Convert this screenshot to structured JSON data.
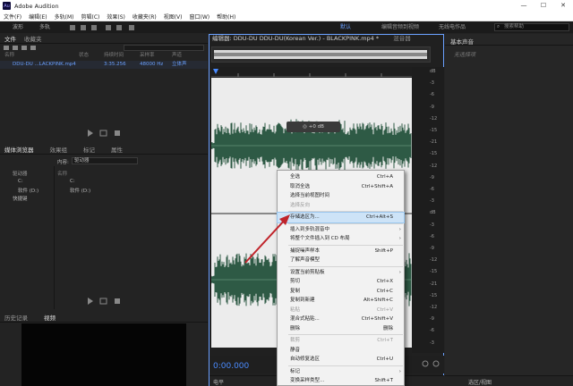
{
  "window": {
    "title": "Adobe Audition",
    "logo": "Au",
    "minimize": "—",
    "maximize": "☐",
    "close": "✕"
  },
  "menu": [
    "文件(F)",
    "编辑(E)",
    "多轨(M)",
    "剪辑(C)",
    "效果(S)",
    "收藏夹(R)",
    "视图(V)",
    "窗口(W)",
    "帮助(H)"
  ],
  "toolbar": {
    "wave_label": "波形",
    "multi_label": "多轨",
    "workspaces": [
      "默认",
      "编辑音频到视频",
      "无线电作品"
    ],
    "search_placeholder": "搜索帮助"
  },
  "files_panel": {
    "tabs": [
      "文件",
      "收藏夹"
    ],
    "columns": [
      "名称",
      "状态",
      "持续时间",
      "采样率",
      "声道"
    ],
    "row": {
      "name": "DDU-DU ...LACKPINK.mp4",
      "duration": "3:35.256",
      "rate": "48000 Hz",
      "channels": "立体声"
    }
  },
  "media_panel": {
    "tabs": [
      "媒体浏览器",
      "效果组",
      "标记",
      "属性"
    ],
    "content_label": "内容:",
    "content_value": "驱动器",
    "tree": [
      "驱动器",
      "C:",
      "软件 (D:)",
      "快捷键"
    ],
    "list_header": "名称",
    "list": [
      "C:",
      "软件 (D:)"
    ]
  },
  "history_panel": {
    "tabs": [
      "历史记录",
      "视频"
    ]
  },
  "editor": {
    "title": "编辑器: DDU-DU DDU-DU(Korean Ver.) - BLACKPINK.mp4 *",
    "mixer_tab": "混音器",
    "hud_label": "+0 dB",
    "time": "0:00.000",
    "db_labels": [
      "dB",
      "-3",
      "-6",
      "-9",
      "-12",
      "-15",
      "-21",
      "-15",
      "-12",
      "-9",
      "-6",
      "-3",
      "dB",
      "-3",
      "-6",
      "-9",
      "-12",
      "-15",
      "-21",
      "-15",
      "-12",
      "-9",
      "-6",
      "-3"
    ]
  },
  "context_menu": {
    "items": [
      {
        "label": "全选",
        "shortcut": "Ctrl+A"
      },
      {
        "label": "取消全选",
        "shortcut": "Ctrl+Shift+A"
      },
      {
        "label": "选择当前视图时间",
        "shortcut": ""
      },
      {
        "label": "选择反向",
        "shortcut": "",
        "disabled": true
      },
      {
        "sep": true
      },
      {
        "label": "存储选区为...",
        "shortcut": "Ctrl+Alt+S",
        "highlight": true
      },
      {
        "sep": true
      },
      {
        "label": "插入到多轨混音中",
        "shortcut": "",
        "submenu": true
      },
      {
        "label": "将整个文件插入到 CD 布局",
        "shortcut": "",
        "submenu": true
      },
      {
        "sep": true
      },
      {
        "label": "捕捉噪声样本",
        "shortcut": "Shift+P"
      },
      {
        "label": "了解声音模型",
        "shortcut": ""
      },
      {
        "sep": true
      },
      {
        "label": "设置当前剪贴板",
        "shortcut": "",
        "submenu": true
      },
      {
        "label": "剪切",
        "shortcut": "Ctrl+X"
      },
      {
        "label": "复制",
        "shortcut": "Ctrl+C"
      },
      {
        "label": "复制到新建",
        "shortcut": "Alt+Shift+C"
      },
      {
        "label": "粘贴",
        "shortcut": "Ctrl+V",
        "disabled": true
      },
      {
        "label": "混合式粘贴...",
        "shortcut": "Ctrl+Shift+V"
      },
      {
        "label": "删除",
        "shortcut": "删除"
      },
      {
        "sep": true
      },
      {
        "label": "裁剪",
        "shortcut": "Ctrl+T",
        "disabled": true
      },
      {
        "label": "静音",
        "shortcut": ""
      },
      {
        "label": "自动修复选区",
        "shortcut": "Ctrl+U"
      },
      {
        "sep": true
      },
      {
        "label": "标记",
        "shortcut": "",
        "submenu": true
      },
      {
        "label": "变换采样类型...",
        "shortcut": "Shift+T"
      }
    ]
  },
  "right_panel": {
    "title": "基本声音",
    "subtitle": "无选择项"
  },
  "bottom": {
    "left_tab": "电平",
    "right_tab": "选区/视图"
  },
  "colors": {
    "accent": "#4a8bff",
    "waveform": "#2e5a45",
    "menu_highlight": "#cde3f7",
    "arrow": "#c0242b"
  }
}
